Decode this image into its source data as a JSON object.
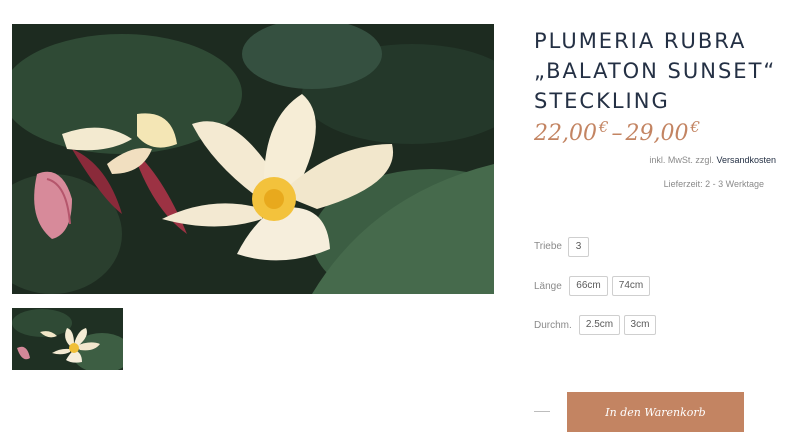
{
  "product": {
    "title_line1": "PLUMERIA RUBRA",
    "title_line2": "„BALATON SUNSET“",
    "title_line3": "STECKLING",
    "price_min": "22,00",
    "price_max": "29,00",
    "currency": "€",
    "price_separator": "–",
    "tax_note": "inkl. MwSt. zzgl.",
    "shipping_link": "Versandkosten",
    "delivery": "Lieferzeit: 2 - 3 Werktage"
  },
  "images": {
    "main_alt": "Plumeria Rubra Balaton Sunset",
    "thumb_alt": "Plumeria Rubra Balaton Sunset thumbnail"
  },
  "options": {
    "triebe": {
      "label": "Triebe",
      "values": [
        "3"
      ]
    },
    "laenge": {
      "label": "Länge",
      "values": [
        "66cm",
        "74cm"
      ]
    },
    "durchm": {
      "label": "Durchm.",
      "values": [
        "2.5cm",
        "3cm"
      ]
    }
  },
  "cart": {
    "button_label": "In den Warenkorb"
  },
  "colors": {
    "accent": "#c38462",
    "title": "#243044",
    "muted": "#8a8a8a"
  }
}
